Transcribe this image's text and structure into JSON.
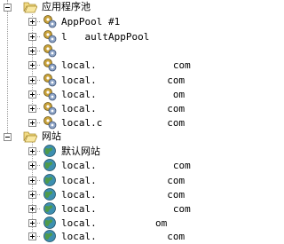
{
  "tree": {
    "app_pools": {
      "label": "应用程序池",
      "items": [
        {
          "label": "AppPool #1",
          "icon": "app-pool-icon"
        },
        {
          "label": "l   aultAppPool",
          "icon": "app-pool-icon"
        },
        {
          "label": "",
          "icon": "app-pool-icon"
        },
        {
          "label": "local.             com",
          "icon": "app-pool-icon"
        },
        {
          "label": "local.            com",
          "icon": "app-pool-icon"
        },
        {
          "label": "local.             om",
          "icon": "app-pool-icon"
        },
        {
          "label": "local.            com",
          "icon": "app-pool-icon"
        },
        {
          "label": "local.c           com",
          "icon": "app-pool-icon"
        }
      ]
    },
    "web_sites": {
      "label": "网站",
      "items": [
        {
          "label": "默认网站",
          "icon": "globe-icon"
        },
        {
          "label": "local.             com",
          "icon": "globe-icon"
        },
        {
          "label": "local.            com",
          "icon": "globe-icon"
        },
        {
          "label": "local.            com",
          "icon": "globe-icon"
        },
        {
          "label": "local.             com",
          "icon": "globe-icon"
        },
        {
          "label": "local.          om",
          "icon": "globe-icon"
        },
        {
          "label": "local.            com",
          "icon": "globe-icon"
        }
      ]
    }
  },
  "colors": {
    "folder": "#e8c860",
    "gear": "#7a8fb0",
    "globe": "#2f7a5a",
    "selection_border": "#6f8fb8"
  }
}
